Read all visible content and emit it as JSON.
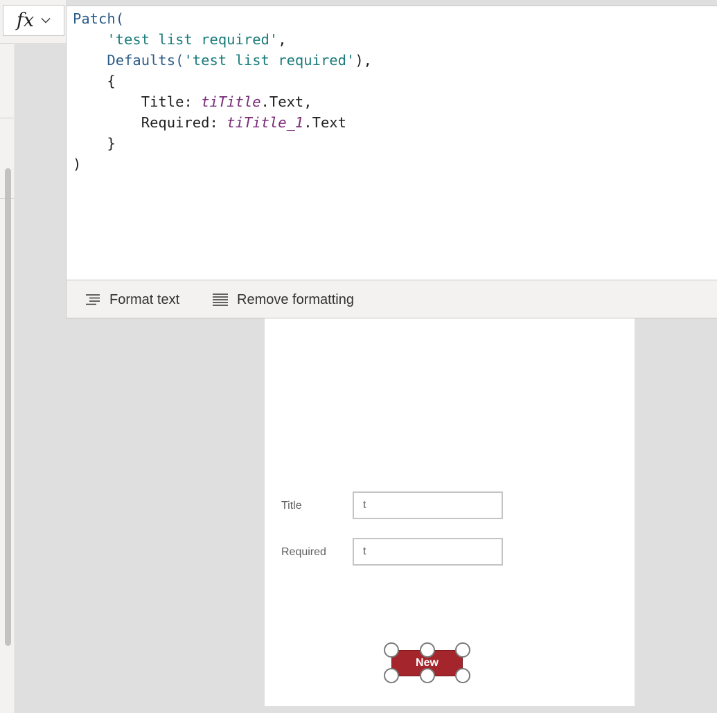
{
  "formula_bar": {
    "fx_label": "fx",
    "code_lines": [
      [
        {
          "t": "Patch(",
          "c": "fn"
        }
      ],
      [
        {
          "t": "    ",
          "c": ""
        },
        {
          "t": "'test list required'",
          "c": "str"
        },
        {
          "t": ",",
          "c": ""
        }
      ],
      [
        {
          "t": "    ",
          "c": ""
        },
        {
          "t": "Defaults(",
          "c": "fn"
        },
        {
          "t": "'test list required'",
          "c": "str"
        },
        {
          "t": "),",
          "c": ""
        }
      ],
      [
        {
          "t": "    {",
          "c": ""
        }
      ],
      [
        {
          "t": "        Title: ",
          "c": ""
        },
        {
          "t": "tiTitle",
          "c": "ctl"
        },
        {
          "t": ".Text,",
          "c": ""
        }
      ],
      [
        {
          "t": "        Required: ",
          "c": ""
        },
        {
          "t": "tiTitle_1",
          "c": "ctl"
        },
        {
          "t": ".Text",
          "c": ""
        }
      ],
      [
        {
          "t": "    }",
          "c": ""
        }
      ],
      [
        {
          "t": ")",
          "c": ""
        }
      ]
    ]
  },
  "toolbar": {
    "format_text": "Format text",
    "remove_formatting": "Remove formatting"
  },
  "form": {
    "title_label": "Title",
    "title_value": "t",
    "required_label": "Required",
    "required_value": "t",
    "new_button": "New"
  },
  "colors": {
    "button_bg": "#a4262c",
    "function": "#2b5c8a",
    "string": "#1a7b7b",
    "control": "#7a2a78"
  }
}
